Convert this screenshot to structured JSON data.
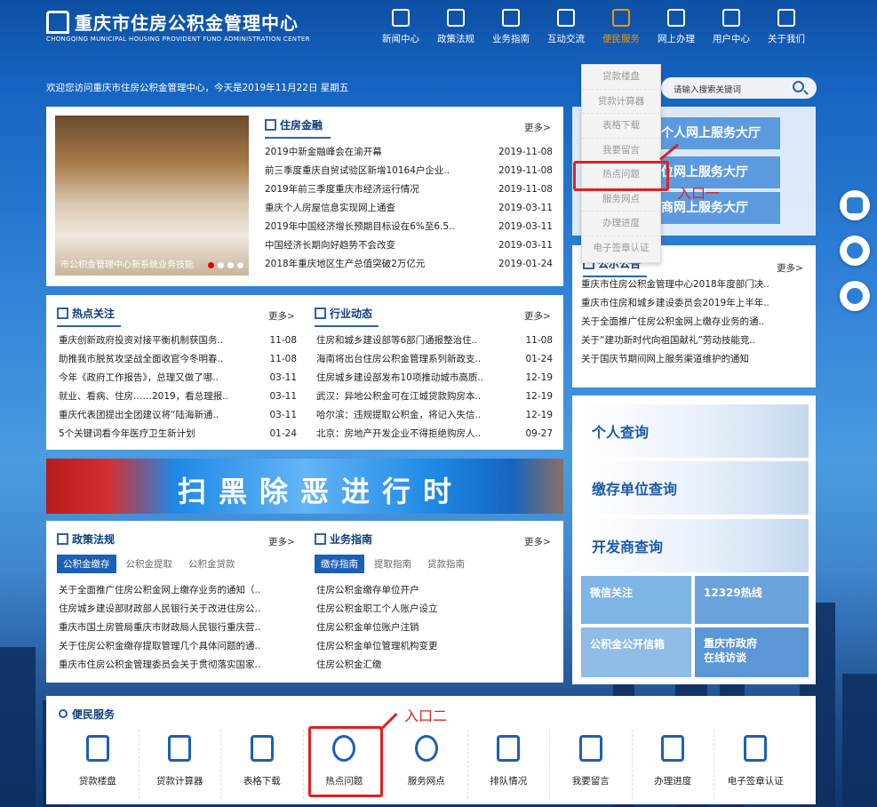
{
  "header": {
    "title": "重庆市住房公积金管理中心",
    "subtitle": "CHONGQING MUNICIPAL HOUSING PROVIDENT FUND ADMINISTRATION CENTER",
    "nav": [
      "新闻中心",
      "政策法规",
      "业务指南",
      "互动交流",
      "便民服务",
      "网上办理",
      "用户中心",
      "关于我们"
    ],
    "dropdown": [
      "贷款楼盘",
      "贷款计算器",
      "表格下载",
      "我要留言",
      "热点问题",
      "服务网点",
      "办理进度",
      "电子签章认证"
    ]
  },
  "welcome": "欢迎您访问重庆市住房公积金管理中心，今天是2019年11月22日 星期五",
  "search": {
    "label": "搜索：",
    "placeholder": "请输入搜索关键词"
  },
  "more": "更多>",
  "finance": {
    "title": "住房金融",
    "photo_caption": "市公积金管理中心新系统业务技能",
    "items": [
      [
        "2019中新金融峰会在渝开幕",
        "2019-11-08"
      ],
      [
        "前三季度重庆自贸试验区新增10164户企业..",
        "2019-11-08"
      ],
      [
        "2019年前三季度重庆市经济运行情况",
        "2019-11-08"
      ],
      [
        "重庆个人房屋信息实现网上通查",
        "2019-03-11"
      ],
      [
        "2019年中国经济增长预期目标设在6%至6.5..",
        "2019-03-11"
      ],
      [
        "中国经济长期向好趋势不会改变",
        "2019-03-11"
      ],
      [
        "2018年重庆地区生产总值突破2万亿元",
        "2019-01-24"
      ]
    ]
  },
  "services_big": [
    "个人网上服务大厅",
    "单位网上服务大厅",
    "开发商网上服务大厅"
  ],
  "notice": {
    "title": "公示公告",
    "items": [
      "重庆市住房公积金管理中心2018年度部门决..",
      "重庆市住房和城乡建设委员会2019年上半年..",
      "关于全面推广住房公积金网上缴存业务的通..",
      "关于“建功新时代向祖国献礼”劳动技能竞..",
      "关于国庆节期间网上服务渠道维护的通知"
    ]
  },
  "hot": {
    "title": "热点关注",
    "items": [
      [
        "重庆创新政府投资对接平衡机制获国务..",
        "11-08"
      ],
      [
        "助推我市脱贫攻坚战全面收官今冬明春..",
        "11-08"
      ],
      [
        "今年《政府工作报告》，总理又做了哪..",
        "03-11"
      ],
      [
        "就业、看病、住房……2019，看总理报..",
        "03-11"
      ],
      [
        "重庆代表团提出全团建议将“陆海新通..",
        "03-11"
      ],
      [
        "5个关键词看今年医疗卫生新计划",
        "01-24"
      ]
    ]
  },
  "industry": {
    "title": "行业动态",
    "items": [
      [
        "住房和城乡建设部等6部门通报整治住..",
        "11-08"
      ],
      [
        "海南将出台住房公积金管理系列新政支..",
        "01-24"
      ],
      [
        "住房城乡建设部发布10项推动城市高质..",
        "12-19"
      ],
      [
        "武汉：异地公积金可在江城贷款购房本..",
        "12-19"
      ],
      [
        "哈尔滨：违规提取公积金，将记入失信..",
        "12-19"
      ],
      [
        "北京：房地产开发企业不得拒绝购房人..",
        "09-27"
      ]
    ]
  },
  "banner": "扫黑除恶进行时",
  "policy": {
    "title": "政策法规",
    "tabs": [
      "公积金缴存",
      "公积金提取",
      "公积金贷款"
    ],
    "items": [
      "关于全面推广住房公积金网上缴存业务的通知（..",
      "住房城乡建设部财政部人民银行关于改进住房公..",
      "重庆市国土房管局重庆市财政局人民银行重庆营..",
      "关于住房公积金缴存提取管理几个具体问题的通..",
      "重庆市住房公积金管理委员会关于贯彻落实国家.."
    ]
  },
  "guide": {
    "title": "业务指南",
    "tabs": [
      "缴存指南",
      "提取指南",
      "贷款指南"
    ],
    "items": [
      "住房公积金缴存单位开户",
      "住房公积金职工个人账户设立",
      "住房公积金单位账户注销",
      "住房公积金单位管理机构变更",
      "住房公积金汇缴"
    ]
  },
  "query": [
    "个人查询",
    "缴存单位查询",
    "开发商查询"
  ],
  "tiles": [
    "微信关注",
    "12329热线",
    "公积金公开信箱",
    "重庆市政府在线访谈"
  ],
  "annotations": {
    "entry1": "入口一",
    "entry2": "入口二"
  },
  "service": {
    "title": "便民服务",
    "items": [
      "贷款楼盘",
      "贷款计算器",
      "表格下载",
      "热点问题",
      "服务网点",
      "排队情况",
      "我要留言",
      "办理进度",
      "电子签章认证"
    ]
  }
}
